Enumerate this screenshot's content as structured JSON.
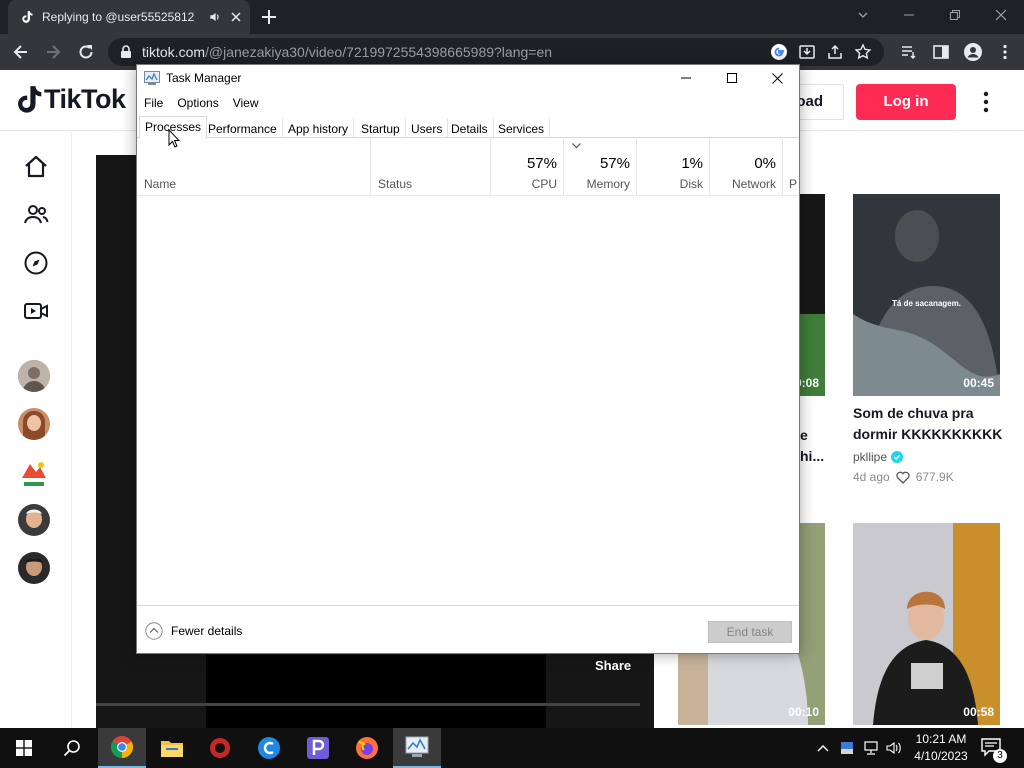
{
  "browser": {
    "tab_title": "Replying to @user55525812",
    "url_host": "tiktok.com",
    "url_path": "/@janezakiya30/video/7219972554398665989?lang=en"
  },
  "tiktok": {
    "logo_text": "TikTok",
    "upload_label": "oad",
    "login_label": "Log in",
    "share_label": "Share",
    "cards": [
      {
        "duration": "0:08",
        "caption_fragment_1": "e",
        "caption_fragment_2": "hi..."
      },
      {
        "duration": "00:45",
        "overlay_text": "Tá de sacanagem.",
        "caption": "Som de chuva pra dormir KKKKKKKKKK",
        "author": "pkllipe",
        "age": "4d ago",
        "likes": "677.9K"
      },
      {
        "duration": "00:10"
      },
      {
        "duration": "00:58"
      }
    ]
  },
  "task_manager": {
    "title": "Task Manager",
    "menu": [
      "File",
      "Options",
      "View"
    ],
    "tabs": [
      "Processes",
      "Performance",
      "App history",
      "Startup",
      "Users",
      "Details",
      "Services"
    ],
    "columns": {
      "name": "Name",
      "status": "Status",
      "cpu": {
        "pct": "57%",
        "label": "CPU"
      },
      "memory": {
        "pct": "57%",
        "label": "Memory"
      },
      "disk": {
        "pct": "1%",
        "label": "Disk"
      },
      "network": {
        "pct": "0%",
        "label": "Network"
      },
      "power_fragment": "P"
    },
    "fewer_details": "Fewer details",
    "end_task": "End task"
  },
  "taskbar": {
    "time": "10:21 AM",
    "date": "4/10/2023",
    "notifications": "3"
  }
}
